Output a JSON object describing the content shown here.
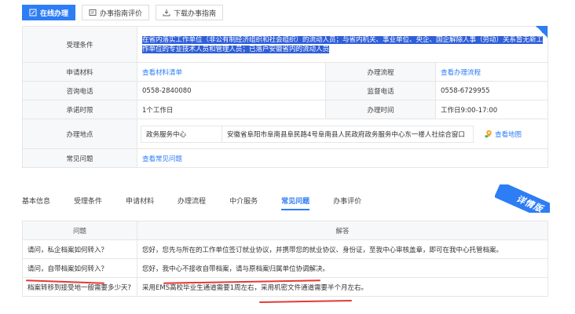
{
  "toolbar": {
    "online": "在线办理",
    "evaluate": "办事指南评价",
    "download": "下载办事指南"
  },
  "info": {
    "condition_label": "受理条件",
    "condition_text": "在省内落实工作单位（非公有制经济组织和社会组织）的流动人员；与省内机关、事业单位、央企、国企解除人事（劳动）关系暂无新工作单位的专业技术人员和管理人员；已落户安徽省内的流动人员",
    "materials_label": "申请材料",
    "materials_value": "查看材料清单",
    "process_label": "办理流程",
    "process_value": "查看办理流程",
    "consult_label": "咨询电话",
    "consult_value": "0558-2840080",
    "supervise_label": "监督电话",
    "supervise_value": "0558-6729955",
    "limit_label": "承诺时限",
    "limit_value": "1个工作日",
    "time_label": "办理时间",
    "time_value": "工作日9:00-17:00",
    "location_label": "办理地点",
    "location_center": "政务服务中心",
    "location_address": "安徽省阜阳市阜南县阜民路4号阜南县人民政府政务服务中心东一楼人社综合窗口",
    "map_link": "查看地图",
    "faq_label": "常见问题",
    "faq_value": "查看常见问题"
  },
  "tabs": [
    {
      "label": "基本信息"
    },
    {
      "label": "受理条件"
    },
    {
      "label": "申请材料"
    },
    {
      "label": "办理流程"
    },
    {
      "label": "中介服务"
    },
    {
      "label": "常见问题"
    },
    {
      "label": "办事评价"
    }
  ],
  "ribbon": "详情版",
  "faq": {
    "col_question": "问题",
    "col_answer": "解答",
    "rows": [
      {
        "q": "请问，私企档案如何转入？",
        "a": "您好，您先与所在的工作单位签订就业协议，并携带您的就业协议、身份证，至我中心审核盖章，即可在我中心托管档案。"
      },
      {
        "q": "请问，自带档案如何转入？",
        "a": "您好，我中心不接收自带档案，请与原档案归属单位协调解决。"
      },
      {
        "q": "档案转移到接受地一般需要多少天?",
        "a": "采用EMS高校毕业生通道需要1周左右，采用机密文件通道需要半个月左右。"
      }
    ]
  },
  "colors": {
    "accent": "#2d7df5",
    "annotation": "#e53935"
  }
}
